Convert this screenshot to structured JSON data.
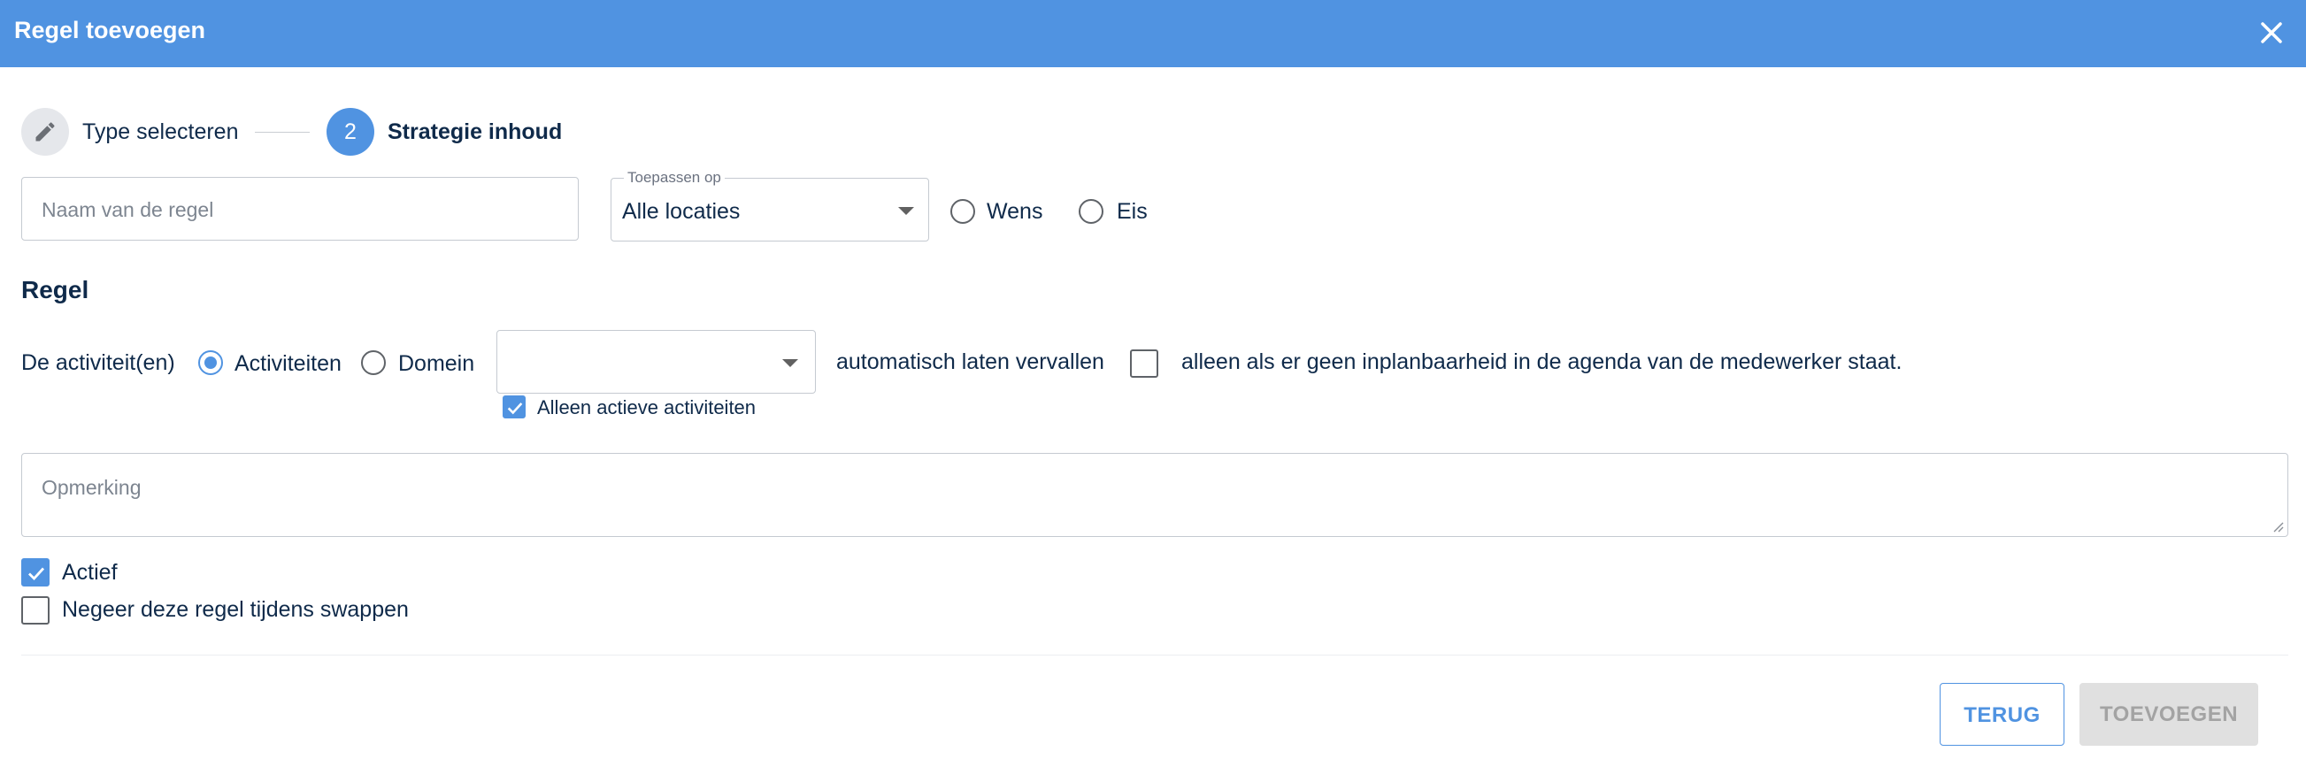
{
  "dialog": {
    "title": "Regel toevoegen",
    "close_icon": "close-icon"
  },
  "stepper": {
    "step1": {
      "icon": "pencil-icon",
      "label": "Type selecteren"
    },
    "step2": {
      "number": "2",
      "label": "Strategie inhoud"
    }
  },
  "form": {
    "name_placeholder": "Naam van de regel",
    "apply_to": {
      "label": "Toepassen op",
      "value": "Alle locaties"
    },
    "priority": [
      {
        "label": "Wens",
        "selected": false
      },
      {
        "label": "Eis",
        "selected": false
      }
    ]
  },
  "rule": {
    "title": "Regel",
    "intro": "De activiteit(en)",
    "type_options": [
      {
        "label": "Activiteiten",
        "selected": true
      },
      {
        "label": "Domein",
        "selected": false
      }
    ],
    "activity_select_value": "",
    "only_active_label": "Alleen actieve activiteiten",
    "only_active_checked": true,
    "auto_expire_text": "automatisch laten vervallen",
    "condition_checked": false,
    "condition_text": "alleen als er geen inplanbaarheid in de agenda van de medewerker staat."
  },
  "remark_placeholder": "Opmerking",
  "flags": [
    {
      "label": "Actief",
      "checked": true
    },
    {
      "label": "Negeer deze regel tijdens swappen",
      "checked": false
    }
  ],
  "buttons": {
    "back": "TERUG",
    "add": "TOEVOEGEN"
  },
  "colors": {
    "primary": "#5093e1",
    "text": "#0f2a4a",
    "disabled_bg": "#e0e0e0",
    "disabled_text": "#a3a3a3"
  }
}
